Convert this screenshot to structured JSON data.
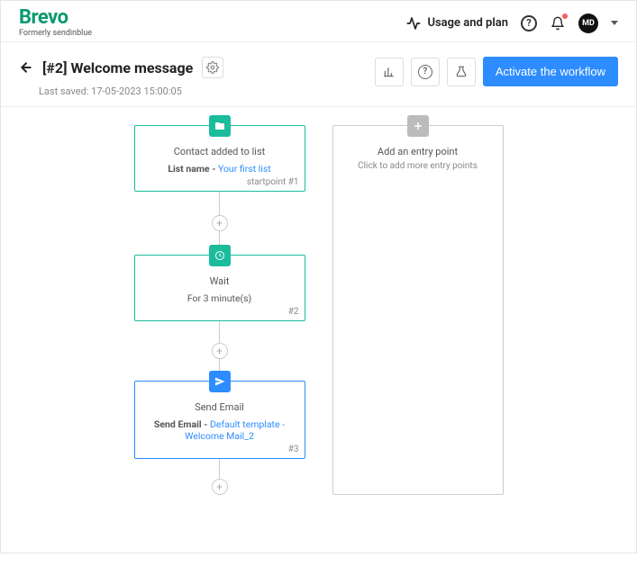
{
  "brand": {
    "name": "Brevo",
    "tagline": "Formerly sendinblue"
  },
  "header": {
    "usage_label": "Usage and plan",
    "avatar_initials": "MD"
  },
  "page": {
    "title": "[#2] Welcome message",
    "last_saved": "Last saved: 17-05-2023 15:00:05",
    "activate_label": "Activate the workflow"
  },
  "workflow": {
    "start": {
      "heading": "Contact added to list",
      "detail_label": "List name - ",
      "detail_link": "Your first list",
      "num": "startpoint #1"
    },
    "entry": {
      "title": "Add an entry point",
      "sub": "Click to add more entry points"
    },
    "wait": {
      "heading": "Wait",
      "detail": "For 3 minute(s)",
      "num": "#2"
    },
    "send": {
      "heading": "Send Email",
      "detail_label": "Send Email - ",
      "detail_link": "Default template -Welcome Mail_2",
      "num": "#3"
    }
  }
}
